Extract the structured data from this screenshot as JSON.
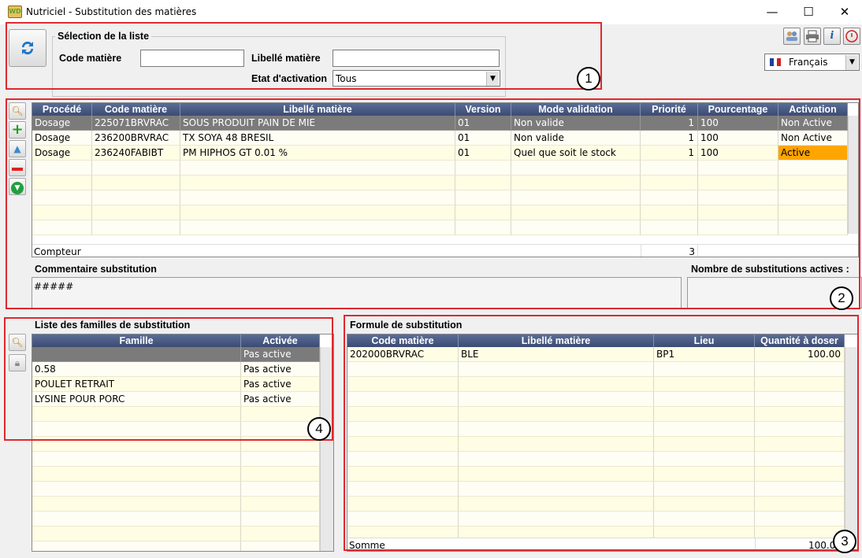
{
  "window": {
    "title": "Nutriciel - Substitution des matières",
    "minimize": "—",
    "maximize": "☐",
    "close": "✕",
    "app_icon_text": "WD"
  },
  "selection": {
    "legend": "Sélection de la liste",
    "code_label": "Code matière",
    "code_value": "",
    "libelle_label": "Libellé matière",
    "libelle_value": "",
    "etat_label": "Etat d'activation",
    "etat_value": "Tous"
  },
  "language": {
    "value": "Français"
  },
  "main_grid": {
    "headers": [
      "Procédé",
      "Code matière",
      "Libellé matière",
      "Version",
      "Mode validation",
      "Priorité",
      "Pourcentage",
      "Activation"
    ],
    "rows": [
      [
        "Dosage",
        "225071BRVRAC",
        "SOUS PRODUIT PAIN DE MIE",
        "01",
        "Non valide",
        "1",
        "100",
        "Non Active"
      ],
      [
        "Dosage",
        "236200BRVRAC",
        "TX SOYA 48 BRESIL",
        "01",
        "Non valide",
        "1",
        "100",
        "Non Active"
      ],
      [
        "Dosage",
        "236240FABIBT",
        "PM HIPHOS GT 0.01 %",
        "01",
        "Quel que soit le stock",
        "1",
        "100",
        "Active"
      ]
    ],
    "footer_label": "Compteur",
    "footer_value": "3",
    "colors": {
      "selected_row": "#7b7b7b",
      "active_cell": "#ffa500",
      "row_alt": "#fffde4"
    }
  },
  "comment": {
    "label": "Commentaire substitution",
    "value": "#####"
  },
  "nb_actives": {
    "label": "Nombre de substitutions actives :",
    "value": ""
  },
  "families": {
    "title": "Liste des familles de substitution",
    "headers": [
      "Famille",
      "Activée"
    ],
    "rows": [
      [
        "",
        "Pas active"
      ],
      [
        "0.58",
        "Pas active"
      ],
      [
        "POULET RETRAIT",
        "Pas active"
      ],
      [
        "LYSINE POUR PORC",
        "Pas active"
      ]
    ]
  },
  "formula": {
    "title": "Formule de substitution",
    "headers": [
      "Code matière",
      "Libellé matière",
      "Lieu",
      "Quantité à doser"
    ],
    "rows": [
      [
        "202000BRVRAC",
        "BLE",
        "BP1",
        "100.00"
      ]
    ],
    "footer_label": "Somme",
    "footer_value": "100.00"
  },
  "annotations": [
    "1",
    "2",
    "3",
    "4"
  ],
  "icons": [
    "refresh-icon",
    "users-icon",
    "print-icon",
    "info-icon",
    "power-icon",
    "search-icon",
    "add-icon",
    "move-up-icon",
    "remove-icon",
    "validate-icon",
    "lock-icon",
    "flag-fr-icon"
  ]
}
